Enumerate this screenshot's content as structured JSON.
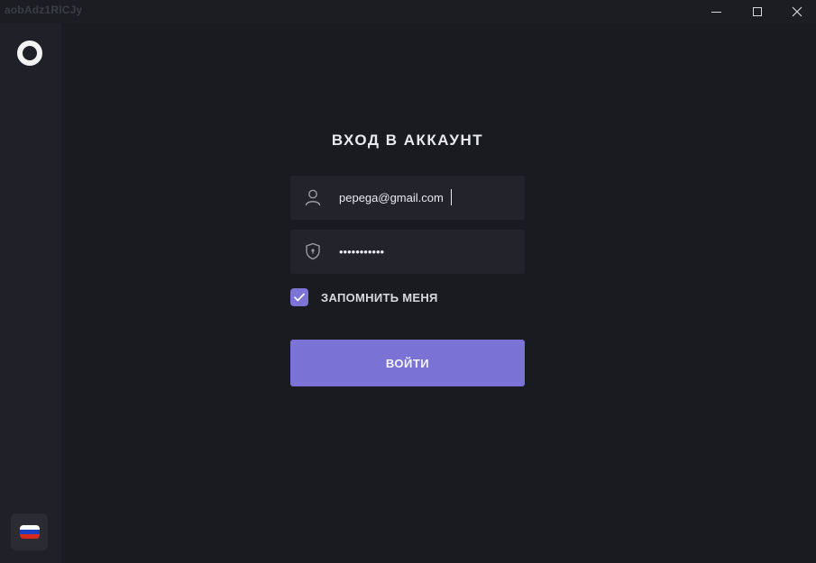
{
  "window": {
    "title": "aobAdz1RlCJy",
    "controls": {
      "minimize": "minimize-icon",
      "maximize": "maximize-icon",
      "close": "close-icon"
    }
  },
  "sidebar": {
    "logo": "ring-logo",
    "language": {
      "icon": "russian-flag-icon",
      "flag_colors": [
        "#ffffff",
        "#1c3fbf",
        "#d52b1e"
      ]
    }
  },
  "login": {
    "title": "ВХОД В АККАУНТ",
    "email": {
      "icon": "user-icon",
      "value": "pepega@gmail.com"
    },
    "password": {
      "icon": "shield-lock-icon",
      "value": "•••••••••••"
    },
    "remember": {
      "label": "ЗАПОМНИТЬ МЕНЯ",
      "checked": true
    },
    "submit_label": "ВОЙТИ"
  },
  "colors": {
    "background": "#1a1b21",
    "sidebar": "#202128",
    "field": "#22232b",
    "accent": "#7b72d5",
    "text": "#e9e9ee"
  }
}
